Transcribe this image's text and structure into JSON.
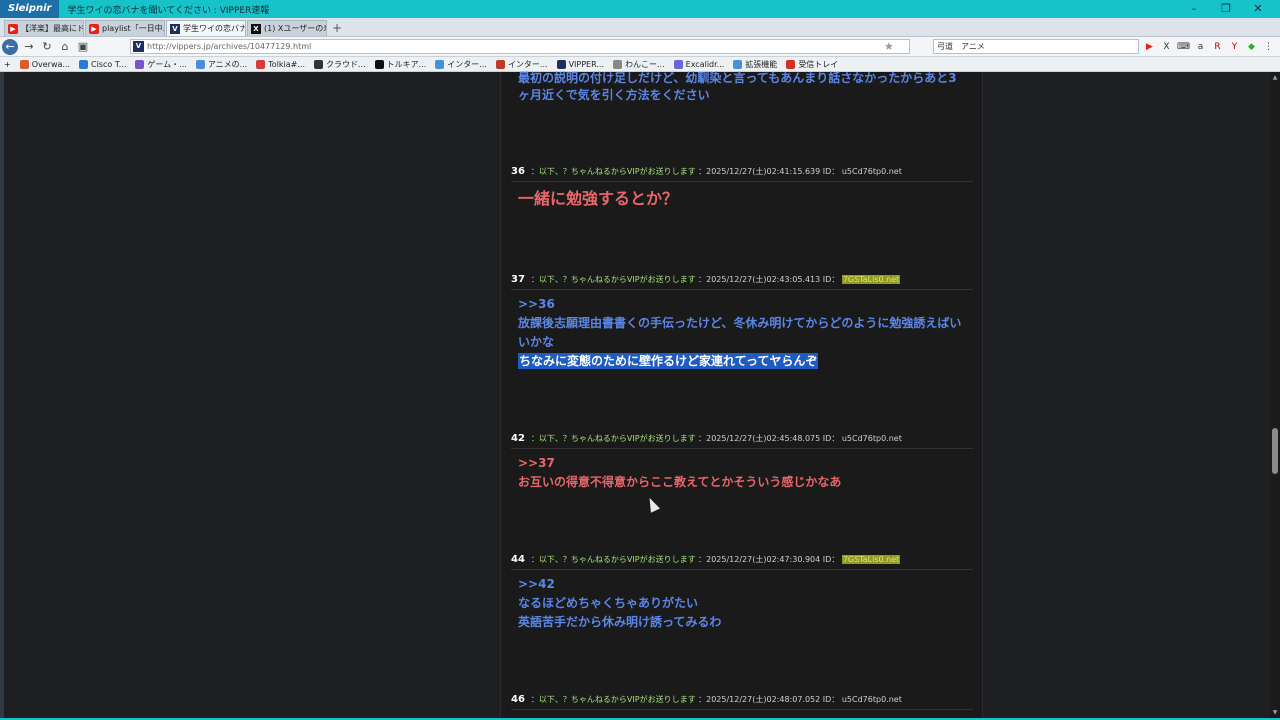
{
  "app": {
    "brand": "Sleipnir",
    "window_title": "学生ワイの恋バナを聞いてください : VIPPER速報"
  },
  "window_controls": [
    "–",
    "❐",
    "✕"
  ],
  "tabs": [
    {
      "label": "【洋楽】最高にド...",
      "icon": "youtube-icon"
    },
    {
      "label": "playlist「一日中...",
      "icon": "youtube-icon"
    },
    {
      "label": "学生ワイの恋バナ...",
      "icon": "vipper-icon",
      "active": true
    },
    {
      "label": "(1) Xユーザーの寿...",
      "icon": "x-icon"
    }
  ],
  "address": {
    "url": "http://vippers.jp/archives/10477129.html"
  },
  "search": {
    "value": "弓道　アニメ"
  },
  "bookmarks": [
    {
      "label": "Overwa...",
      "color": "#e05a2a"
    },
    {
      "label": "Cisco T...",
      "color": "#2b7bd6"
    },
    {
      "label": "ゲーム・...",
      "color": "#7b54c9"
    },
    {
      "label": "アニメの...",
      "color": "#4a90d9"
    },
    {
      "label": "Tolkia#...",
      "color": "#d63a3a"
    },
    {
      "label": "クラウド...",
      "color": "#333333"
    },
    {
      "label": "トルキア...",
      "color": "#111111"
    },
    {
      "label": "インター...",
      "color": "#4a90d9"
    },
    {
      "label": "インター...",
      "color": "#c0392b"
    },
    {
      "label": "VIPPER...",
      "color": "#1c2f5e"
    },
    {
      "label": "わんこー...",
      "color": "#888888"
    },
    {
      "label": "Excalidr...",
      "color": "#6965db"
    },
    {
      "label": "拡張機能",
      "color": "#4a90d9"
    },
    {
      "label": "受信トレイ",
      "color": "#d93025"
    }
  ],
  "posts": {
    "prev_text": {
      "line1": "最初の説明の付け足しだけど、幼馴染と言ってもあんまり話さなかったからあと3",
      "line2": "ヶ月近くで気を引く方法をください"
    },
    "p36": {
      "num": "36",
      "name": "：以下、？ちゃんねるからVIPがお送りします",
      "date": "：2025/12/27(土)02:41:15.639",
      "id_label": "ID：",
      "id": "u5Cd76tp0.net",
      "text": "一緒に勉強するとか？"
    },
    "p37": {
      "num": "37",
      "name": "：以下、？ちゃんねるからVIPがお送りします",
      "date": "：2025/12/27(土)02:43:05.413",
      "id_label": "ID：",
      "id": "7GSTaLis0.net",
      "anchor": ">>36",
      "line1": "放課後志願理由書書くの手伝ったけど、冬休み明けてからどのように勉強誘えばい",
      "line2": "いかな",
      "selected": "ちなみに変態のために壁作るけど家連れてってヤらんぞ"
    },
    "p42": {
      "num": "42",
      "name": "：以下、？ちゃんねるからVIPがお送りします",
      "date": "：2025/12/27(土)02:45:48.075",
      "id_label": "ID：",
      "id": "u5Cd76tp0.net",
      "anchor": ">>37",
      "line1": "お互いの得意不得意からここ教えてとかそういう感じかなあ"
    },
    "p44": {
      "num": "44",
      "name": "：以下、？ちゃんねるからVIPがお送りします",
      "date": "：2025/12/27(土)02:47:30.904",
      "id_label": "ID：",
      "id": "7GSTaLis0.net",
      "anchor": ">>42",
      "line1": "なるほどめちゃくちゃありがたい",
      "line2": "英語苦手だから休み明け誘ってみるわ"
    },
    "p46": {
      "num": "46",
      "name": "：以下、？ちゃんねるからVIPがお送りします",
      "date": "：2025/12/27(土)02:48:07.052",
      "id_label": "ID：",
      "id": "u5Cd76tp0.net"
    }
  }
}
